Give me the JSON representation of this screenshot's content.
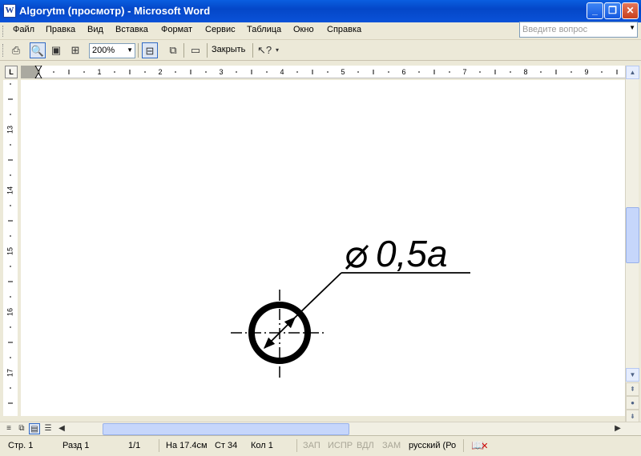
{
  "window": {
    "title": "Algorytm (просмотр) - Microsoft Word",
    "icon": "word-doc-icon"
  },
  "menu": {
    "items": [
      {
        "label": "Файл"
      },
      {
        "label": "Правка"
      },
      {
        "label": "Вид"
      },
      {
        "label": "Вставка"
      },
      {
        "label": "Формат"
      },
      {
        "label": "Сервис"
      },
      {
        "label": "Таблица"
      },
      {
        "label": "Окно"
      },
      {
        "label": "Справка"
      }
    ],
    "help_placeholder": "Введите вопрос"
  },
  "toolbar": {
    "zoom": "200%",
    "close_label": "Закрыть",
    "icons": [
      "print-icon",
      "magnifier-icon",
      "one-page-icon",
      "multiple-pages-icon",
      "view-ruler-icon",
      "shrink-to-fit-icon",
      "full-screen-icon",
      "context-help-icon"
    ]
  },
  "ruler": {
    "horizontal_numbers": [
      "1",
      "2",
      "3",
      "4",
      "5",
      "6",
      "7",
      "8",
      "9"
    ],
    "vertical_numbers": [
      "13",
      "14",
      "15",
      "16",
      "17"
    ]
  },
  "drawing": {
    "dimension_symbol": "⌀",
    "dimension_text": "0,5a"
  },
  "statusbar": {
    "page": "Стр. 1",
    "section": "Разд 1",
    "page_of": "1/1",
    "at": "На 17.4см",
    "line": "Ст 34",
    "col": "Кол 1",
    "rec": "ЗАП",
    "trk": "ИСПР",
    "ext": "ВДЛ",
    "ovr": "ЗАМ",
    "language": "русский (Ро"
  }
}
